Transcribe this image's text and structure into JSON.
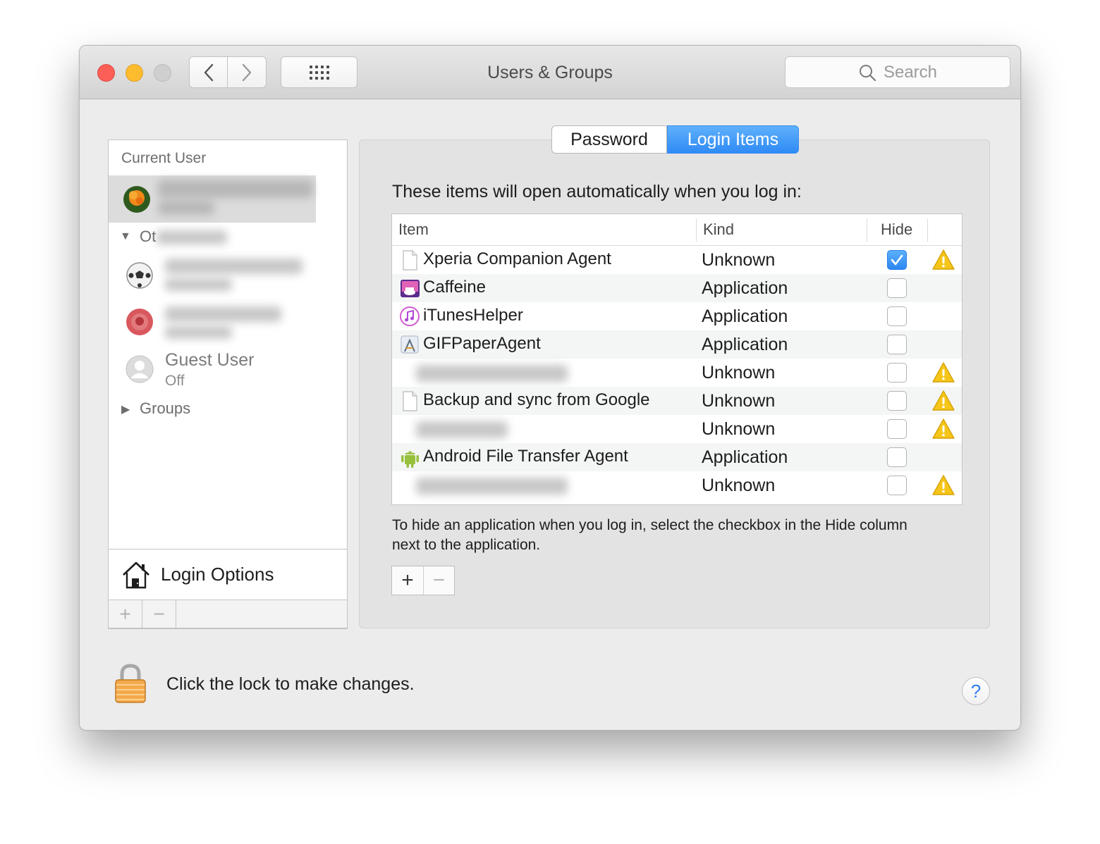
{
  "window": {
    "title": "Users & Groups",
    "search_placeholder": "Search"
  },
  "toolbar": {
    "back_glyph": "‹",
    "forward_glyph": "›",
    "grid_icon": "show-all-grid-icon"
  },
  "sidebar": {
    "current_user_header": "Current User",
    "other_users_header_visible": "Ot",
    "guest_user": {
      "name": "Guest User",
      "status": "Off"
    },
    "groups_label": "Groups",
    "login_options_label": "Login Options",
    "add_glyph": "+",
    "remove_glyph": "−"
  },
  "tabs": {
    "password": "Password",
    "login_items": "Login Items",
    "selected": "Login Items"
  },
  "login_items": {
    "intro": "These items will open automatically when you log in:",
    "columns": {
      "item": "Item",
      "kind": "Kind",
      "hide": "Hide"
    },
    "rows": [
      {
        "name": "Xperia Companion Agent",
        "kind": "Unknown",
        "hide": true,
        "warning": true,
        "icon": "document-icon"
      },
      {
        "name": "Caffeine",
        "kind": "Application",
        "hide": false,
        "warning": false,
        "icon": "caffeine-app-icon"
      },
      {
        "name": "iTunesHelper",
        "kind": "Application",
        "hide": false,
        "warning": false,
        "icon": "itunes-icon"
      },
      {
        "name": "GIFPaperAgent",
        "kind": "Application",
        "hide": false,
        "warning": false,
        "icon": "app-generic-icon"
      },
      {
        "name": "",
        "kind": "Unknown",
        "hide": false,
        "warning": true,
        "icon": "blurred"
      },
      {
        "name": "Backup and sync from Google",
        "kind": "Unknown",
        "hide": false,
        "warning": true,
        "icon": "document-icon"
      },
      {
        "name": "",
        "kind": "Unknown",
        "hide": false,
        "warning": true,
        "icon": "blurred"
      },
      {
        "name": "Android File Transfer Agent",
        "kind": "Application",
        "hide": false,
        "warning": false,
        "icon": "android-icon"
      },
      {
        "name": "",
        "kind": "Unknown",
        "hide": false,
        "warning": true,
        "icon": "blurred"
      }
    ],
    "help_text": "To hide an application when you log in, select the checkbox in the Hide column next to the application.",
    "add_glyph": "+",
    "remove_glyph": "−"
  },
  "footer": {
    "lock_text": "Click the lock to make changes.",
    "help_glyph": "?"
  },
  "colors": {
    "accent": "#2f8bf5",
    "warning": "#f5c518",
    "window_bg": "#ececec"
  }
}
